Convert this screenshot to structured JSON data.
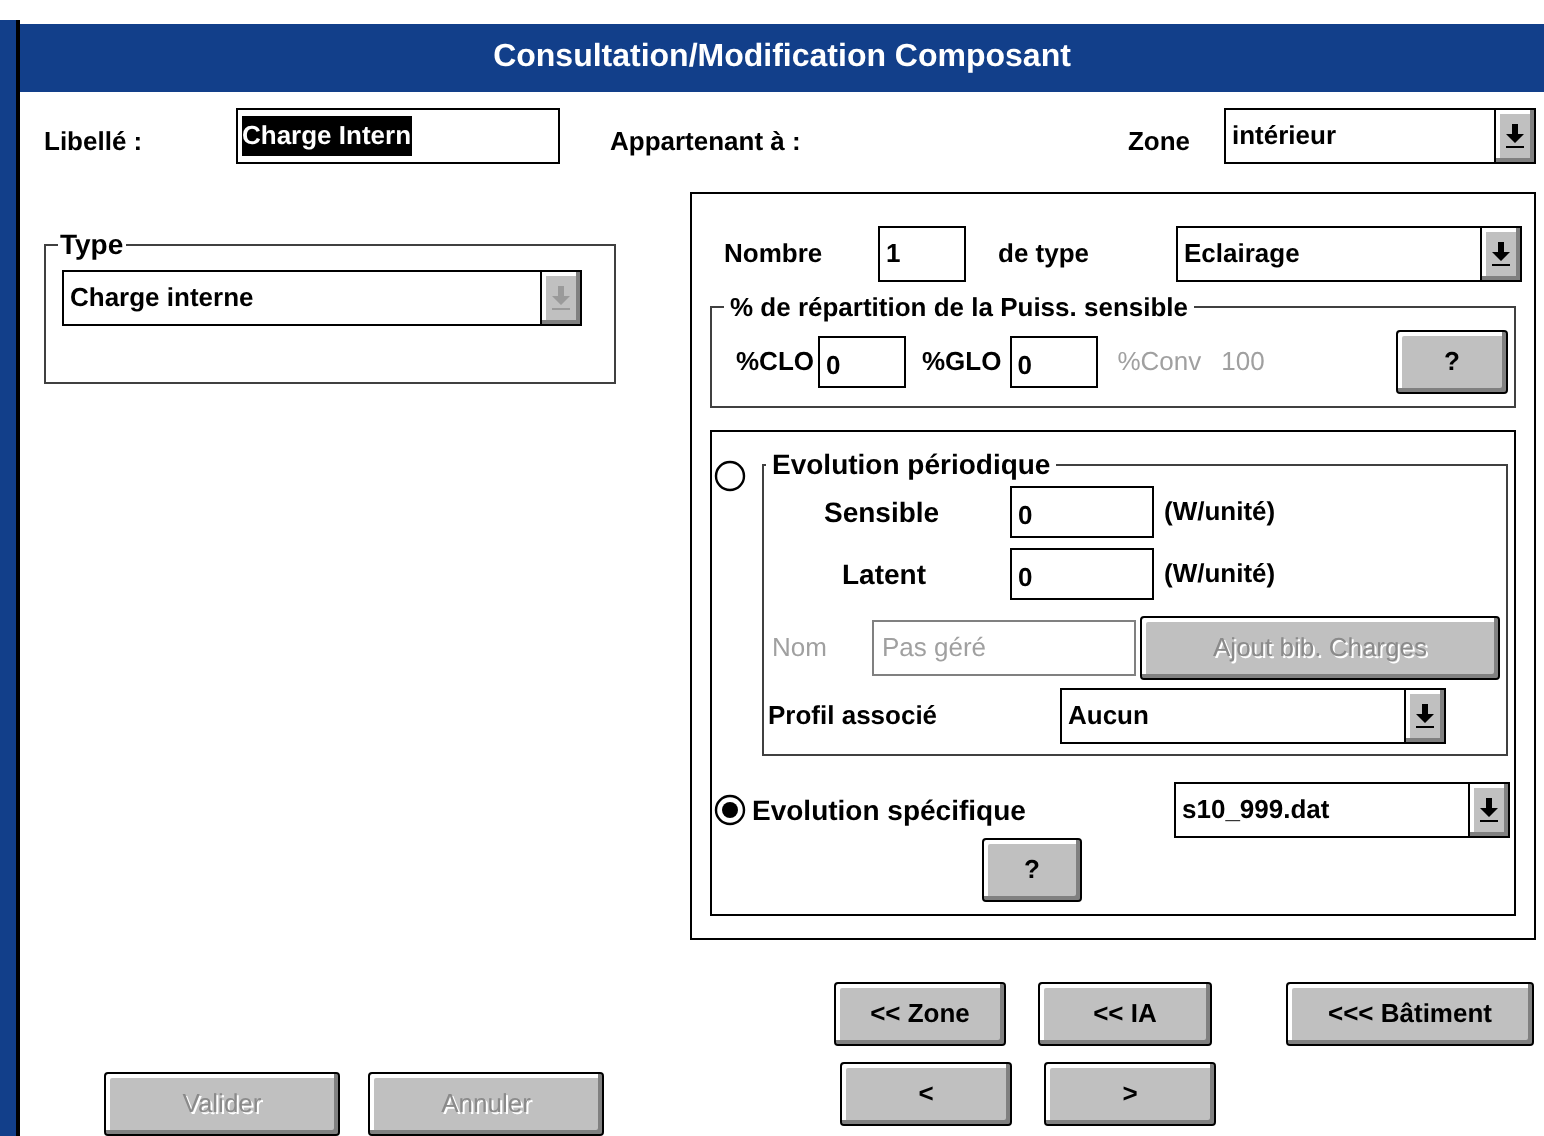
{
  "window": {
    "title": "Consultation/Modification Composant"
  },
  "libelle": {
    "label": "Libellé :",
    "value": "Charge Intern",
    "highlighted": true
  },
  "appartenant": {
    "label": "Appartenant à :"
  },
  "zone": {
    "label": "Zone",
    "combo": {
      "value": "intérieur",
      "disabled": false
    }
  },
  "type_group": {
    "legend": "Type",
    "combo": {
      "value": "Charge interne",
      "disabled": true
    }
  },
  "nombre": {
    "label": "Nombre",
    "value": "1"
  },
  "de_type": {
    "label": "de type",
    "combo": {
      "value": "Eclairage",
      "disabled": false
    }
  },
  "repartition": {
    "legend": "% de répartition de la Puiss. sensible",
    "fields": [
      {
        "label": "%CLO",
        "value": "0"
      },
      {
        "label": "%GLO",
        "value": "0"
      }
    ],
    "conv": {
      "label": "%Conv",
      "value": "100",
      "disabled": true
    },
    "help_button": {
      "label": "?",
      "disabled": false
    }
  },
  "evolution_periodique": {
    "radio": {
      "selected": false
    },
    "legend": "Evolution périodique",
    "rows": [
      {
        "label": "Sensible",
        "value": "0",
        "unit": "(W/unité)"
      },
      {
        "label": "Latent",
        "value": "0",
        "unit": "(W/unité)"
      }
    ],
    "nom": {
      "label": "Nom",
      "value": "Pas géré",
      "disabled": true
    },
    "ajout_button": {
      "label": "Ajout bib. Charges",
      "disabled": true
    },
    "profil": {
      "label": "Profil associé",
      "combo": {
        "value": "Aucun",
        "disabled": false
      }
    }
  },
  "evolution_specifique": {
    "radio": {
      "label": "Evolution spécifique",
      "selected": true
    },
    "combo": {
      "value": "s10_999.dat",
      "disabled": false
    },
    "help_button": {
      "label": "?",
      "disabled": false
    }
  },
  "navigation": [
    [
      {
        "label": "<< Zone",
        "disabled": false
      },
      {
        "label": "<< IA",
        "disabled": false
      },
      {
        "label": "<<< Bâtiment",
        "disabled": false
      }
    ],
    [
      {
        "label": "<",
        "disabled": false
      },
      {
        "label": ">",
        "disabled": false
      }
    ]
  ],
  "actions": [
    {
      "label": "Valider",
      "disabled": true
    },
    {
      "label": "Annuler",
      "disabled": true
    }
  ]
}
